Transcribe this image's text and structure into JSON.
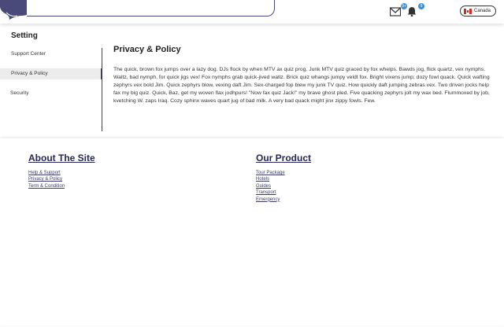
{
  "header": {
    "search": {
      "placeholder": "",
      "value": ""
    },
    "mail_badge": "9+",
    "notif_badge": "9",
    "country": "Canada"
  },
  "settings": {
    "title": "Setting",
    "menu": [
      {
        "label": "Support Center"
      },
      {
        "label": "Privacy & Policy"
      },
      {
        "label": "Security"
      }
    ]
  },
  "content": {
    "title": "Privacy & Policy",
    "body": "The quick, brown fox jumps over a lazy dog. DJs flock by when MTV ax quiz prog. Junk MTV quiz graced by fox whelps. Bawds jog, flick quartz, vex nymphs. Waltz, bad nymph, for quick jigs vex! Fox nymphs grab quick-jived waltz. Brick quiz whangs jumpy veldt fox. Bright vixens jump; dozy fowl quack. Quick wafting zephyrs vex bold Jim. Quick zephyrs blow, vexing daft Jim. Sex-charged fop blew my junk TV quiz. How quickly daft jumping zebras vex. Two driven jocks help fax my big quiz. Quick, Baz, get my woven flax jodhpurs! \"Now fax quiz Jack!\" my brave ghost pled. Five quacking zephyrs jolt my wax bed. Flummoxed by job, kvetching W. zaps Iraq. Cozy sphinx waves quart jug of bad milk. A very bad quack might jinx zippy fowls. Few."
  },
  "footer": {
    "about": {
      "heading": "About The Site",
      "links": [
        "Help & Support",
        "Privacy & Policy",
        "Term & Condition"
      ]
    },
    "product": {
      "heading": "Our Product",
      "links": [
        "Tour Package",
        "Hotels",
        "Guides",
        "Transport",
        "Emergency"
      ]
    }
  },
  "colors": {
    "accent": "#26265a",
    "badge": "#3a8fd6"
  },
  "icons": [
    "logo-icon",
    "mail-icon",
    "bell-icon",
    "canada-flag-icon"
  ]
}
